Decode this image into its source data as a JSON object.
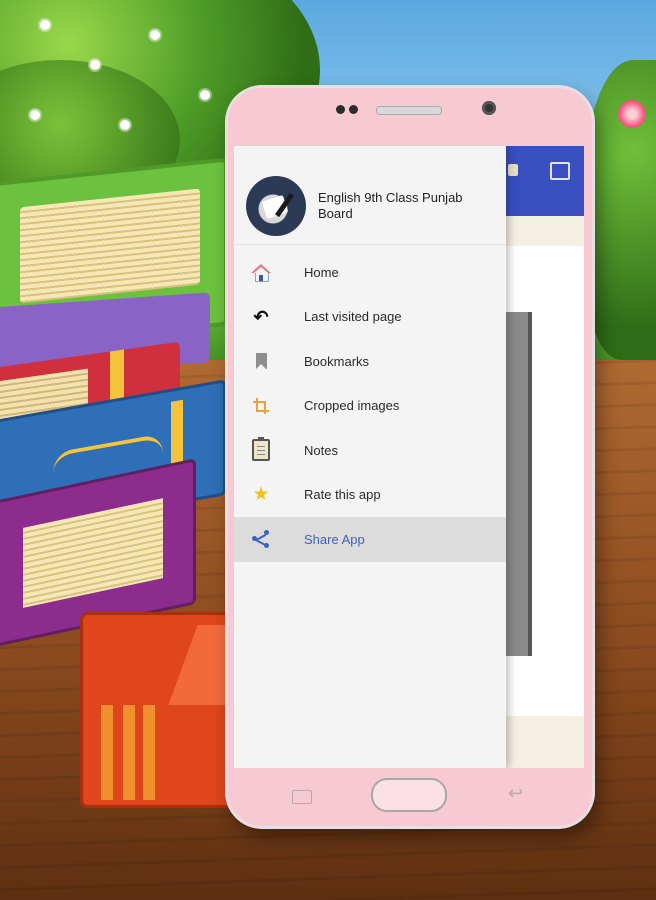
{
  "drawer": {
    "app_title": "English 9th Class Punjab Board",
    "items": [
      {
        "label": "Home",
        "icon": "home-icon"
      },
      {
        "label": "Last visited page",
        "icon": "undo-icon"
      },
      {
        "label": "Bookmarks",
        "icon": "bookmark-icon"
      },
      {
        "label": "Cropped images",
        "icon": "crop-icon"
      },
      {
        "label": "Notes",
        "icon": "notes-icon"
      },
      {
        "label": "Rate this app",
        "icon": "star-icon"
      },
      {
        "label": "Share App",
        "icon": "share-icon",
        "selected": true
      }
    ]
  },
  "colors": {
    "phone_body": "#f7c9d2",
    "app_toolbar": "#3a4fc0",
    "selected_item_bg": "#dcdcdc",
    "selected_item_text": "#3b63c4",
    "star": "#f3c21c"
  }
}
